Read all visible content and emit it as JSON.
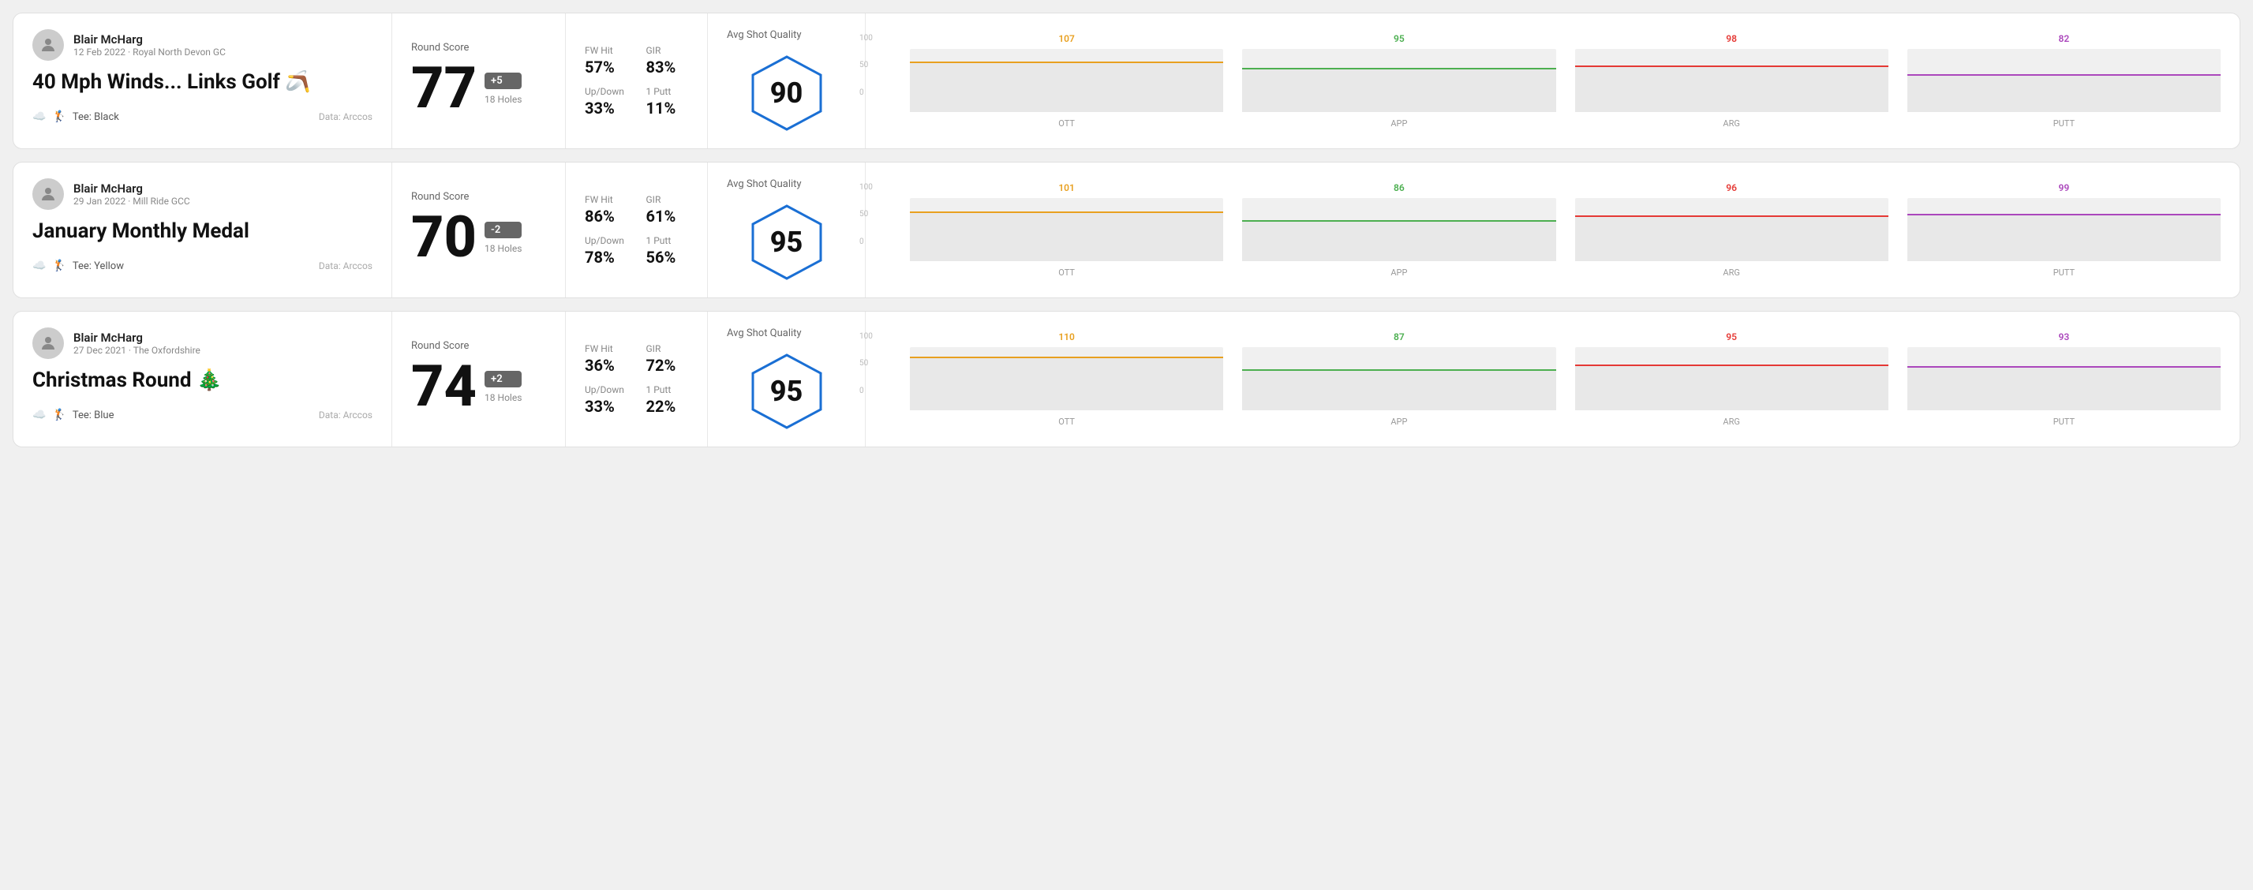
{
  "rounds": [
    {
      "id": "round1",
      "user": {
        "name": "Blair McHarg",
        "meta": "12 Feb 2022 · Royal North Devon GC"
      },
      "title": "40 Mph Winds... Links Golf 🪃",
      "tee": "Black",
      "data_source": "Data: Arccos",
      "score": {
        "label": "Round Score",
        "value": "77",
        "badge": "+5",
        "badge_type": "plus",
        "holes": "18 Holes"
      },
      "stats": {
        "fw_hit_label": "FW Hit",
        "fw_hit_value": "57%",
        "gir_label": "GIR",
        "gir_value": "83%",
        "updown_label": "Up/Down",
        "updown_value": "33%",
        "oneputt_label": "1 Putt",
        "oneputt_value": "11%"
      },
      "quality": {
        "label": "Avg Shot Quality",
        "value": "90"
      },
      "chart": {
        "bars": [
          {
            "label": "OTT",
            "value": 107,
            "color": "#e8a020",
            "pct": 80
          },
          {
            "label": "APP",
            "value": 95,
            "color": "#4caf50",
            "pct": 70
          },
          {
            "label": "ARG",
            "value": 98,
            "color": "#e53935",
            "pct": 73
          },
          {
            "label": "PUTT",
            "value": 82,
            "color": "#ab47bc",
            "pct": 60
          }
        ]
      }
    },
    {
      "id": "round2",
      "user": {
        "name": "Blair McHarg",
        "meta": "29 Jan 2022 · Mill Ride GCC"
      },
      "title": "January Monthly Medal",
      "tee": "Yellow",
      "data_source": "Data: Arccos",
      "score": {
        "label": "Round Score",
        "value": "70",
        "badge": "-2",
        "badge_type": "minus",
        "holes": "18 Holes"
      },
      "stats": {
        "fw_hit_label": "FW Hit",
        "fw_hit_value": "86%",
        "gir_label": "GIR",
        "gir_value": "61%",
        "updown_label": "Up/Down",
        "updown_value": "78%",
        "oneputt_label": "1 Putt",
        "oneputt_value": "56%"
      },
      "quality": {
        "label": "Avg Shot Quality",
        "value": "95"
      },
      "chart": {
        "bars": [
          {
            "label": "OTT",
            "value": 101,
            "color": "#e8a020",
            "pct": 78
          },
          {
            "label": "APP",
            "value": 86,
            "color": "#4caf50",
            "pct": 64
          },
          {
            "label": "ARG",
            "value": 96,
            "color": "#e53935",
            "pct": 72
          },
          {
            "label": "PUTT",
            "value": 99,
            "color": "#ab47bc",
            "pct": 75
          }
        ]
      }
    },
    {
      "id": "round3",
      "user": {
        "name": "Blair McHarg",
        "meta": "27 Dec 2021 · The Oxfordshire"
      },
      "title": "Christmas Round 🎄",
      "tee": "Blue",
      "data_source": "Data: Arccos",
      "score": {
        "label": "Round Score",
        "value": "74",
        "badge": "+2",
        "badge_type": "plus",
        "holes": "18 Holes"
      },
      "stats": {
        "fw_hit_label": "FW Hit",
        "fw_hit_value": "36%",
        "gir_label": "GIR",
        "gir_value": "72%",
        "updown_label": "Up/Down",
        "updown_value": "33%",
        "oneputt_label": "1 Putt",
        "oneputt_value": "22%"
      },
      "quality": {
        "label": "Avg Shot Quality",
        "value": "95"
      },
      "chart": {
        "bars": [
          {
            "label": "OTT",
            "value": 110,
            "color": "#e8a020",
            "pct": 85
          },
          {
            "label": "APP",
            "value": 87,
            "color": "#4caf50",
            "pct": 65
          },
          {
            "label": "ARG",
            "value": 95,
            "color": "#e53935",
            "pct": 72
          },
          {
            "label": "PUTT",
            "value": 93,
            "color": "#ab47bc",
            "pct": 70
          }
        ]
      }
    }
  ]
}
